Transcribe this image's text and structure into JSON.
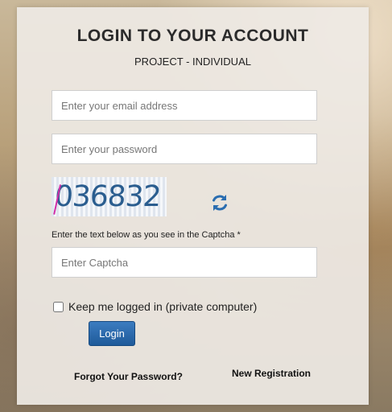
{
  "login": {
    "title": "LOGIN TO YOUR ACCOUNT",
    "subtitle": "PROJECT - INDIVIDUAL",
    "email_placeholder": "Enter your email address",
    "password_placeholder": "Enter your password",
    "captcha_image_text": "036832",
    "captcha_label": "Enter the text below as you see in the Captcha *",
    "captcha_placeholder": "Enter Captcha",
    "remember_label": "Keep me logged in (private computer)",
    "login_button": "Login",
    "forgot_link": "Forgot Your Password?",
    "register_link": "New Registration",
    "accent_color": "#2a6db0"
  }
}
